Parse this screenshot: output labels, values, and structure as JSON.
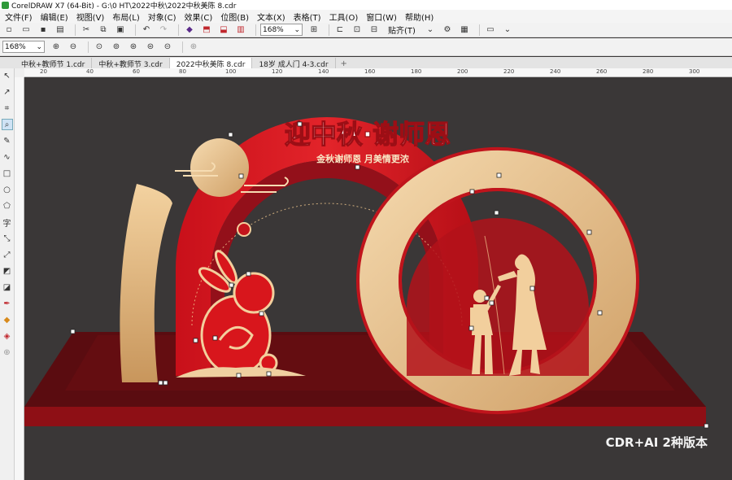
{
  "titlebar": {
    "text": "CorelDRAW X7 (64-Bit) - G:\\0 HT\\2022中秋\\2022中秋美陈 8.cdr"
  },
  "menu": [
    "文件(F)",
    "编辑(E)",
    "视图(V)",
    "布局(L)",
    "对象(C)",
    "效果(C)",
    "位图(B)",
    "文本(X)",
    "表格(T)",
    "工具(O)",
    "窗口(W)",
    "帮助(H)"
  ],
  "toolbar": {
    "zoom_value": "168%",
    "snap_label": "贴齐(T)"
  },
  "propertybar": {
    "zoom_value": "168%"
  },
  "tabs": [
    {
      "label": "中秋+教师节 1.cdr",
      "active": false
    },
    {
      "label": "中秋+教师节 3.cdr",
      "active": false
    },
    {
      "label": "2022中秋美陈 8.cdr",
      "active": true
    },
    {
      "label": "18岁 成人门 4-3.cdr",
      "active": false
    }
  ],
  "ruler": {
    "labels": [
      "20",
      "40",
      "60",
      "80",
      "100",
      "120",
      "140",
      "160",
      "180",
      "200",
      "220",
      "240",
      "260",
      "280",
      "300"
    ]
  },
  "artwork": {
    "headline": "迎中秋·谢师恩",
    "subline": "金秋谢师恩  月美情更浓"
  },
  "watermark": "CDR+AI 2种版本",
  "colors": {
    "red": "#d8161c",
    "dark_red": "#8f0e14",
    "gold_light": "#f2d2a4",
    "gold_dark": "#d2a46b",
    "canvas": "#3a3737"
  }
}
